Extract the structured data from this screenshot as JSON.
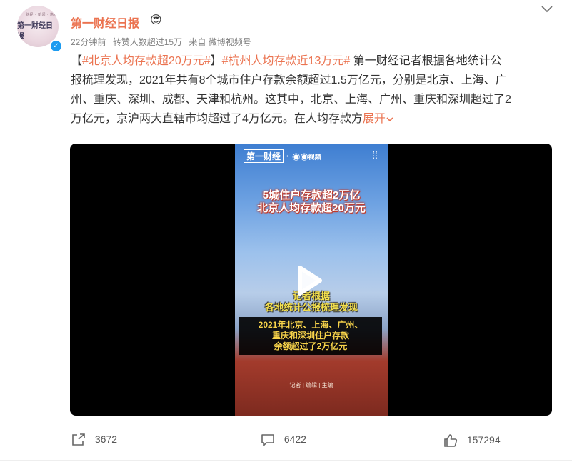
{
  "author": {
    "name": "第一财经日报",
    "emoji": "😍"
  },
  "avatar": {
    "line1": "第一财经 · 新闻 · 热点",
    "line2": "第一财经日报"
  },
  "meta": {
    "time": "22分钟前",
    "likes_info": "转赞人数超过15万",
    "source": "来自 微博视频号"
  },
  "post": {
    "bracket_open": "【",
    "tag1": "#北京人均存款超20万元#",
    "bracket_close": "】",
    "tag2": "#杭州人均存款近13万元#",
    "body_line1": " 第一财经记者根据各地统计公",
    "body_line2": "报梳理发现，2021年共有8个城市住户存款余额超过1.5万亿元，分别是北京、上海、广",
    "body_line3": "州、重庆、深圳、成都、天津和杭州。这其中，北京、上海、广州、重庆和深圳超过了2",
    "body_line4": "万亿元，京沪两大直辖市均超过了4万亿元。在人均存款方",
    "expand": "展开",
    "expand_icon": "chevron-down-icon"
  },
  "video": {
    "logo": "第一财经",
    "logo_extra": "·",
    "logo2": "◉◉",
    "logo2_text": "视频",
    "title_line1": "5城住户存款超2万亿",
    "title_line2": "北京人均存款超20万元",
    "sub_line1": "记者根据",
    "sub_line2": "各地统计公报梳理发现",
    "box_line1": "2021年北京、上海、广州、",
    "box_line2": "重庆和深圳住户存款",
    "box_line3": "余额超过了2万亿元",
    "credit": "记者 | 编辑 | 主编"
  },
  "footer": {
    "share_count": "3672",
    "comment_count": "6422",
    "like_count": "157294"
  }
}
